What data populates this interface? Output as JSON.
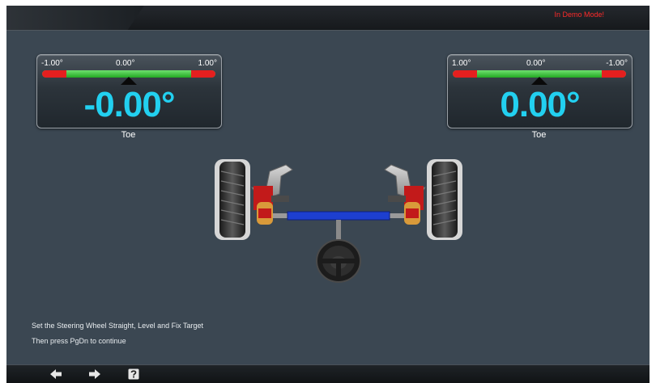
{
  "header": {
    "demo_mode": "In Demo Mode!"
  },
  "gauges": {
    "left": {
      "scale_min": "-1.00°",
      "scale_mid": "0.00°",
      "scale_max": "1.00°",
      "value": "-0.00°",
      "caption": "Toe",
      "position": 0.5
    },
    "right": {
      "scale_min": "1.00°",
      "scale_mid": "0.00°",
      "scale_max": "-1.00°",
      "value": "0.00°",
      "caption": "Toe",
      "position": 0.5
    }
  },
  "instructions": {
    "line1": "Set the Steering Wheel Straight, Level and Fix Target",
    "line2": "Then press PgDn to continue"
  },
  "toolbar": {
    "back_icon": "arrow-left-icon",
    "next_icon": "arrow-right-icon",
    "help_icon": "help-icon"
  },
  "colors": {
    "background": "#3b4752",
    "value": "#22d0f0",
    "in_range": "#33c133",
    "out_of_range": "#e51f1f",
    "demo_text": "#ff2a2a"
  }
}
